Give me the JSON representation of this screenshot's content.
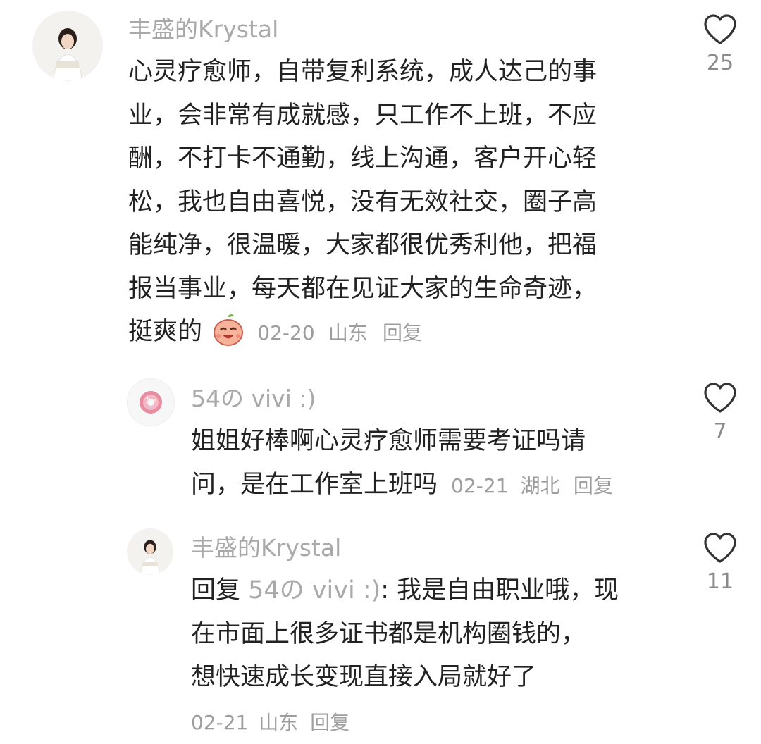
{
  "comments": [
    {
      "username": "丰盛的Krystal",
      "lines": [
        "心灵疗愈师，自带复利系统，成人达己的事",
        "业，会非常有成就感，只工作不上班，不应",
        "酬，不打卡不通勤，线上沟通，客户开心轻",
        "松，我也自由喜悦，没有无效社交，圈子高",
        "能纯净，很温暖，大家都很优秀利他，把福",
        "报当事业，每天都在见证大家的生命奇迹，"
      ],
      "last_line": "挺爽的",
      "emoji": "laughing-peach-emoji",
      "date": "02-20",
      "location": "山东",
      "reply_label": "回复",
      "likes": "25"
    },
    {
      "username": "54の vivi :)",
      "lines": [
        "姐姐好棒啊心灵疗愈师需要考证吗请"
      ],
      "last_line": "问，是在工作室上班吗",
      "date": "02-21",
      "location": "湖北",
      "reply_label": "回复",
      "likes": "7"
    },
    {
      "username": "丰盛的Krystal",
      "reply_prefix": "回复",
      "reply_target": "54の vivi :)",
      "reply_rest": ": 我是自由职业哦，现",
      "lines": [
        "在市面上很多证书都是机构圈钱的，",
        "想快速成长变现直接入局就好了"
      ],
      "date": "02-21",
      "location": "山东",
      "reply_label": "回复",
      "likes": "11"
    }
  ],
  "colors": {
    "username": "#a9a9a9",
    "text": "#222222",
    "meta": "#9d9d9d",
    "heart_outline": "#333333"
  },
  "icons": {
    "like": "heart-outline-icon"
  }
}
